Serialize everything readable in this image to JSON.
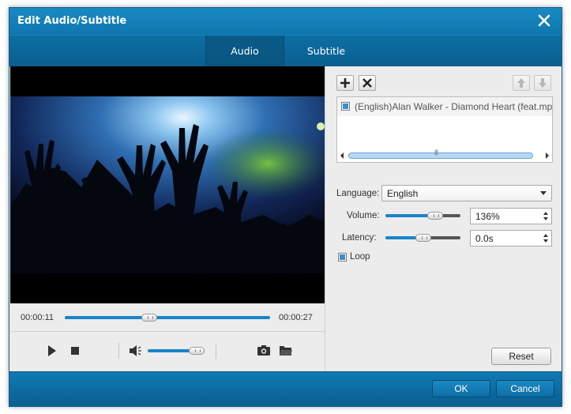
{
  "window": {
    "title": "Edit Audio/Subtitle"
  },
  "tabs": [
    {
      "label": "Audio",
      "active": true
    },
    {
      "label": "Subtitle",
      "active": false
    }
  ],
  "player": {
    "current_time": "00:00:11",
    "total_time": "00:00:27",
    "seek_progress": 0.41,
    "volume_level": 0.86
  },
  "audio_list": {
    "items": [
      {
        "label": "(English)Alan Walker - Diamond Heart (feat.mp",
        "checked": true
      }
    ]
  },
  "settings": {
    "language_label": "Language:",
    "language_value": "English",
    "volume_label": "Volume:",
    "volume_value": "136%",
    "volume_slider": 0.66,
    "latency_label": "Latency:",
    "latency_value": "0.0s",
    "latency_slider": 0.5,
    "loop_label": "Loop",
    "loop_checked": true,
    "reset_label": "Reset"
  },
  "footer": {
    "ok_label": "OK",
    "cancel_label": "Cancel"
  },
  "colors": {
    "titlebar": "#1a8ac3",
    "tabbar": "#0c6ea4",
    "accent": "#1a84c7",
    "footer": "#0f7ab3"
  }
}
